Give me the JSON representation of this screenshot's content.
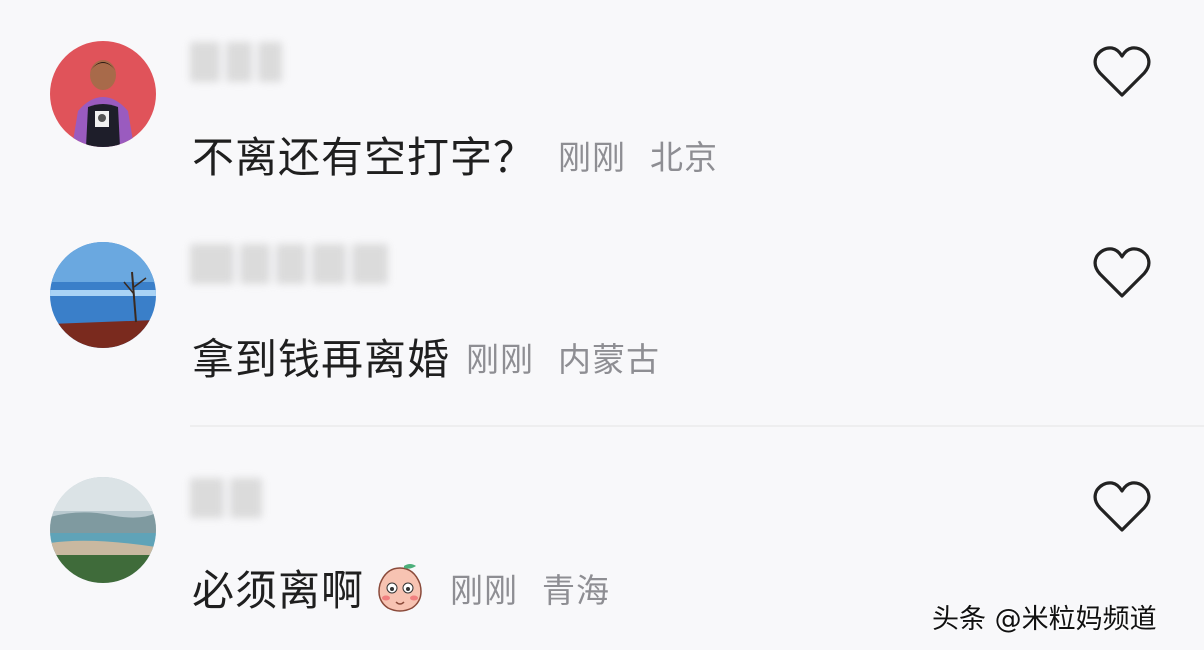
{
  "comments": [
    {
      "text": "不离还有空打字？",
      "time": "刚刚",
      "location": "北京",
      "avatar_colors": {
        "bg": "#e0535a",
        "shirt": "#1e1e2a",
        "jacket": "#9a5bbf"
      }
    },
    {
      "text": "拿到钱再离婚",
      "time": "刚刚",
      "location": "内蒙古",
      "avatar_colors": {
        "sky": "#3a7fc9",
        "ground": "#7a2a1e"
      }
    },
    {
      "text": "必须离啊",
      "time": "刚刚",
      "location": "青海",
      "has_emoji": true,
      "emoji": "peach-blush-emoji",
      "avatar_colors": {
        "sky": "#b9c9cf",
        "water": "#5fa3b8",
        "land": "#3f6b3a"
      }
    }
  ],
  "like_icon": "heart-outline-icon",
  "watermark": "头条 @米粒妈频道",
  "colors": {
    "text": "#1f1f1f",
    "meta": "#8e8e93",
    "background": "#f8f8fa"
  }
}
